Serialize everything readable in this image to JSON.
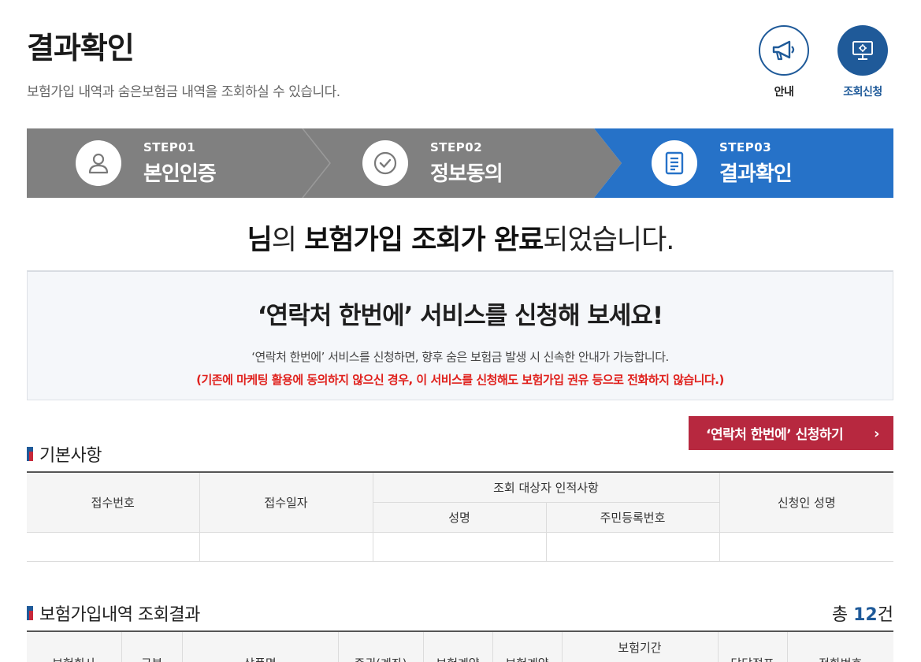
{
  "header": {
    "title": "결과확인",
    "description": "보험가입 내역과 숨은보험금 내역을 조회하실 수 있습니다.",
    "guide_label": "안내",
    "request_label": "조회신청"
  },
  "steps": [
    {
      "num": "STEP01",
      "name": "본인인증",
      "state": "done"
    },
    {
      "num": "STEP02",
      "name": "정보동의",
      "state": "done"
    },
    {
      "num": "STEP03",
      "name": "결과확인",
      "state": "active"
    }
  ],
  "colors": {
    "step_inactive": "#808080",
    "step_active": "#2672c8",
    "primary": "#1f5a99",
    "apply_button": "#b7283f",
    "warning": "#e0211d"
  },
  "complete": {
    "part1": "님",
    "part2": "의 ",
    "part3": "보험가입 조회가 완료",
    "part4": "되었습니다."
  },
  "promo": {
    "title": "‘연락처 한번에’ 서비스를 신청해 보세요!",
    "description": "‘연락처 한번에’ 서비스를 신청하면, 향후 숨은 보험금 발생 시 신속한 안내가 가능합니다.",
    "warning": "(기존에 마케팅 활용에 동의하지 않으신 경우, 이 서비스를 신청해도 보험가입 권유 등으로 전화하지 않습니다.)"
  },
  "apply_button": {
    "label": "‘연락처 한번에’ 신청하기",
    "arrow": "›"
  },
  "basic_section": {
    "title": "기본사항",
    "columns": {
      "receipt_no": "접수번호",
      "receipt_date": "접수일자",
      "target_group": "조회 대상자 인적사항",
      "name": "성명",
      "resident_no": "주민등록번호",
      "applicant_name": "신청인 성명"
    },
    "row": {
      "receipt_no": "",
      "receipt_date": "",
      "name": "",
      "resident_no": "",
      "applicant_name": ""
    }
  },
  "result_section": {
    "title": "보험가입내역 조회결과",
    "total_prefix": "총 ",
    "total_count": "12",
    "total_suffix": "건",
    "columns": {
      "company": "보험회사",
      "type": "구분",
      "product": "상품명",
      "policy_no": "증권(계좌)",
      "contract_a": "보험계약",
      "contract_b": "보험계약",
      "period": "보험기간",
      "branch": "담당점포",
      "phone": "전화번호"
    }
  }
}
